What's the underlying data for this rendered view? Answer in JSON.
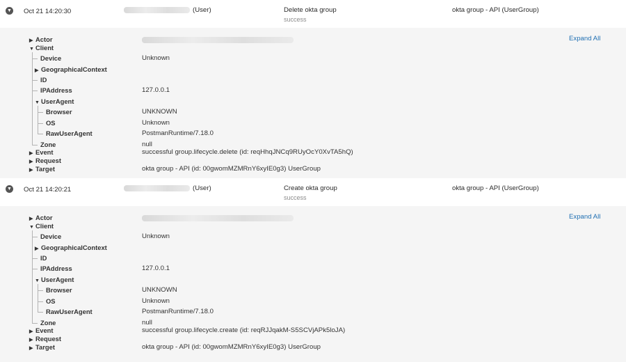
{
  "ui": {
    "expand_all": "Expand All",
    "labels": {
      "actor": "Actor",
      "client": "Client",
      "device": "Device",
      "geo": "GeographicalContext",
      "id": "ID",
      "ip": "IPAddress",
      "ua": "UserAgent",
      "browser": "Browser",
      "os": "OS",
      "raw": "RawUserAgent",
      "zone": "Zone",
      "event": "Event",
      "request": "Request",
      "target": "Target"
    }
  },
  "events": [
    {
      "time": "Oct 21 14:20:30",
      "actor_suffix": "(User)",
      "action": "Delete okta group",
      "outcome": "success",
      "target": "okta group - API  (UserGroup)",
      "client": {
        "device": "Unknown",
        "ip": "127.0.0.1",
        "browser": "UNKNOWN",
        "os": "Unknown",
        "raw": "PostmanRuntime/7.18.0",
        "zone": "null"
      },
      "event_value": "successful group.lifecycle.delete (id: reqHhqJNCq9RUyOcY0XvTA5hQ)",
      "target_value": "okta group - API (id: 00gwomMZMRnY6xyIE0g3) UserGroup"
    },
    {
      "time": "Oct 21 14:20:21",
      "actor_suffix": "(User)",
      "action": "Create okta group",
      "outcome": "success",
      "target": "okta group - API  (UserGroup)",
      "client": {
        "device": "Unknown",
        "ip": "127.0.0.1",
        "browser": "UNKNOWN",
        "os": "Unknown",
        "raw": "PostmanRuntime/7.18.0",
        "zone": "null"
      },
      "event_value": "successful group.lifecycle.create (id: reqRJJqakM-S5SCVjAPk5loJA)",
      "target_value": "okta group - API (id: 00gwomMZMRnY6xyIE0g3) UserGroup"
    }
  ]
}
